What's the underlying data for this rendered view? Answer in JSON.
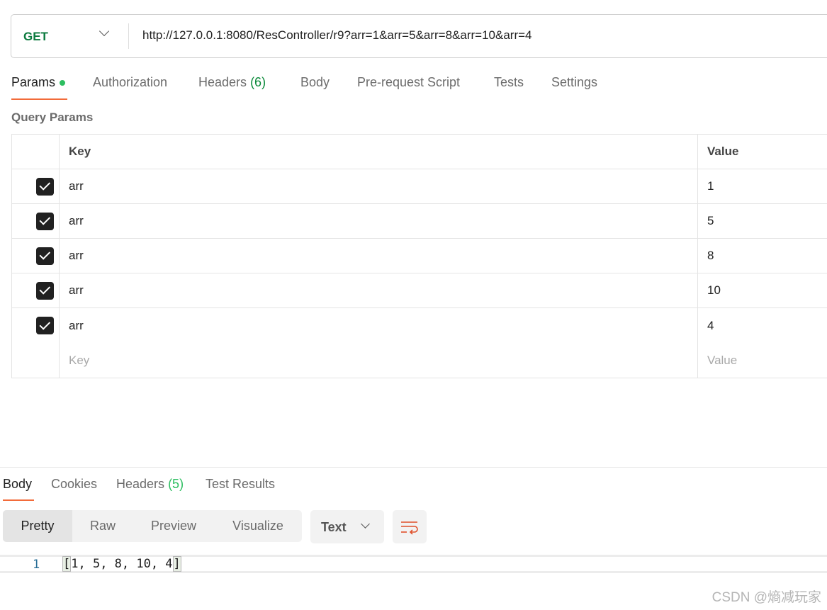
{
  "request": {
    "method": "GET",
    "url": "http://127.0.0.1:8080/ResController/r9?arr=1&arr=5&arr=8&arr=10&arr=4"
  },
  "tabs": {
    "params": "Params",
    "authorization": "Authorization",
    "headers": "Headers",
    "headers_count": "(6)",
    "body": "Body",
    "prerequest": "Pre-request Script",
    "tests": "Tests",
    "settings": "Settings"
  },
  "query_params": {
    "title": "Query Params",
    "key_header": "Key",
    "value_header": "Value",
    "rows": [
      {
        "key": "arr",
        "value": "1",
        "checked": true
      },
      {
        "key": "arr",
        "value": "5",
        "checked": true
      },
      {
        "key": "arr",
        "value": "8",
        "checked": true
      },
      {
        "key": "arr",
        "value": "10",
        "checked": true
      },
      {
        "key": "arr",
        "value": "4",
        "checked": true
      }
    ],
    "key_placeholder": "Key",
    "value_placeholder": "Value"
  },
  "response": {
    "tabs": {
      "body": "Body",
      "cookies": "Cookies",
      "headers": "Headers",
      "headers_count": "(5)",
      "test_results": "Test Results"
    },
    "views": [
      "Pretty",
      "Raw",
      "Preview",
      "Visualize"
    ],
    "format": "Text",
    "line_number": "1",
    "body_open": "[",
    "body_inner": "1, 5, 8, 10, 4",
    "body_close": "]"
  },
  "watermark": "CSDN @熵减玩家",
  "colors": {
    "accent": "#f26b3a",
    "method": "#0b7a3e",
    "status_dot": "#2dbe60"
  }
}
